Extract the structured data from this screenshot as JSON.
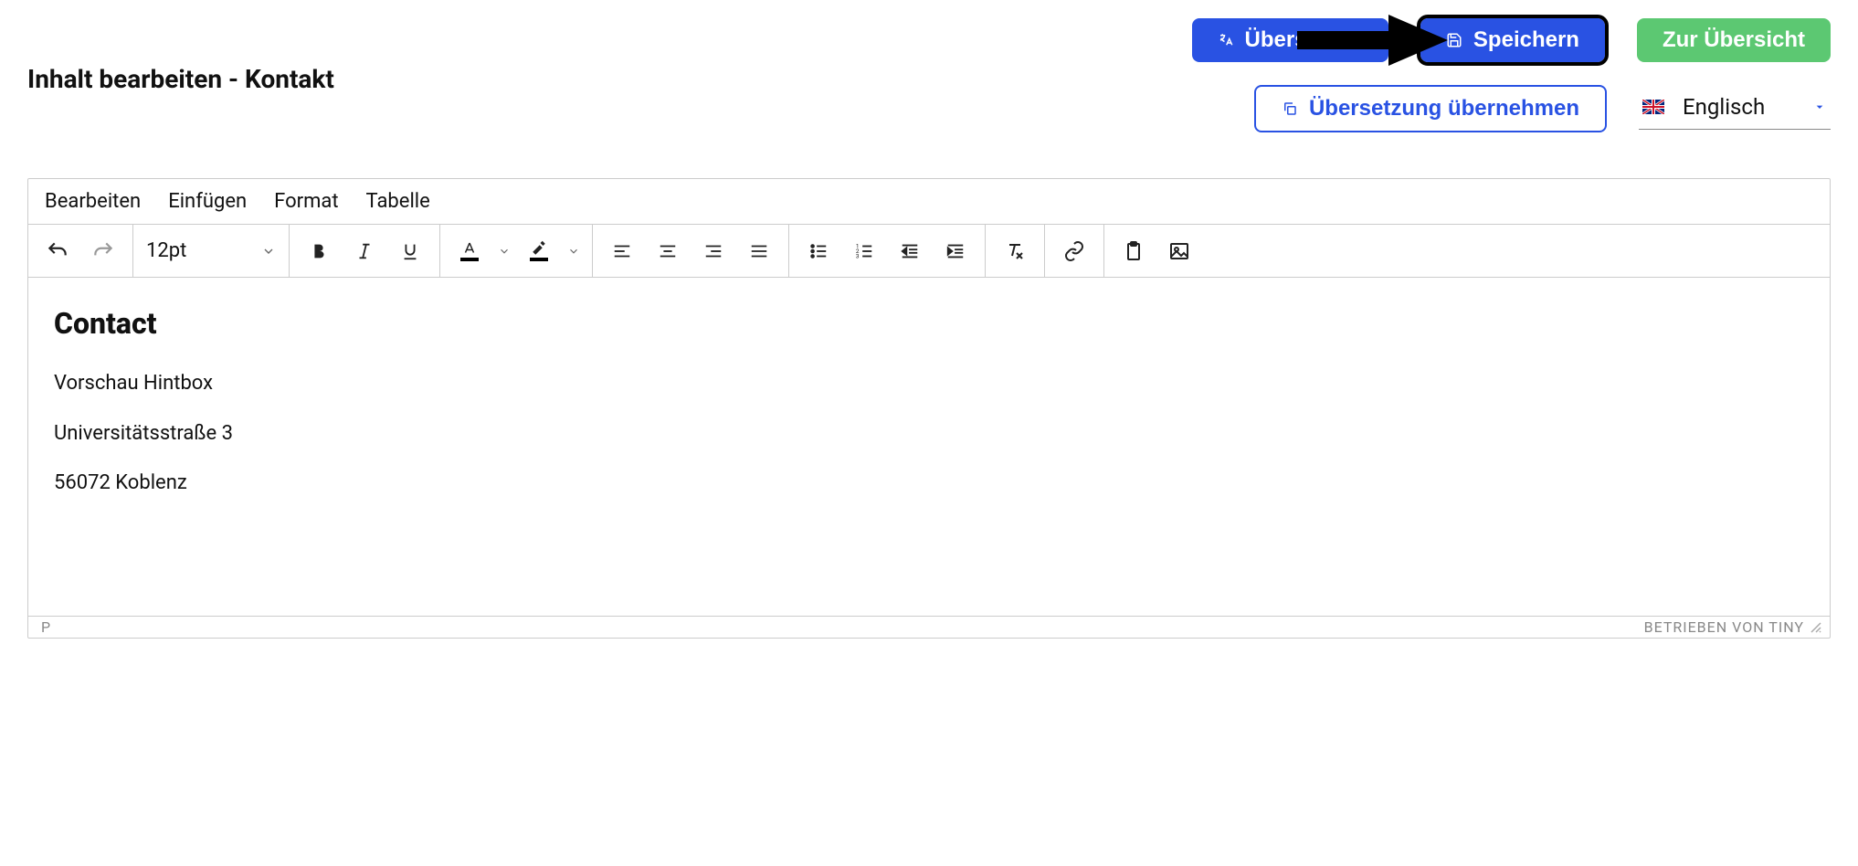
{
  "page_title": "Inhalt bearbeiten - Kontakt",
  "buttons": {
    "translate": "Übersetzen",
    "save": "Speichern",
    "overview": "Zur Übersicht",
    "apply_translation": "Übersetzung übernehmen"
  },
  "language_selector": {
    "label": "Englisch"
  },
  "editor": {
    "menubar": [
      "Bearbeiten",
      "Einfügen",
      "Format",
      "Tabelle"
    ],
    "font_size": "12pt",
    "content": {
      "heading": "Contact",
      "lines": [
        "Vorschau Hintbox",
        "Universitätsstraße 3",
        "56072 Koblenz"
      ]
    },
    "statusbar_path": "P",
    "powered_by": "BETRIEBEN VON TINY"
  }
}
